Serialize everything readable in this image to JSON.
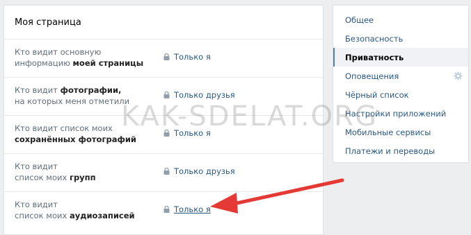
{
  "main": {
    "title": "Моя страница",
    "rows": [
      {
        "label_plain": "Кто видит основную",
        "label_plain2": "информацию ",
        "label_bold": "моей страницы",
        "value": "Только я"
      },
      {
        "label_plain": "Кто видит ",
        "label_bold": "фотографии,",
        "label_plain2": "на которых меня отметили",
        "value": "Только друзья"
      },
      {
        "label_plain": "Кто видит список моих",
        "label_bold": "сохранённых фотографий",
        "value": "Только я"
      },
      {
        "label_plain": "Кто видит",
        "label_plain2": "список моих ",
        "label_bold": "групп",
        "value": "Только друзья"
      },
      {
        "label_plain": "Кто видит",
        "label_plain2": "список моих ",
        "label_bold": "аудиозаписей",
        "value": "Только я"
      }
    ]
  },
  "sidebar": {
    "items": [
      {
        "label": "Общее"
      },
      {
        "label": "Безопасность"
      },
      {
        "label": "Приватность"
      },
      {
        "label": "Оповещения"
      },
      {
        "label": "Чёрный список"
      },
      {
        "label": "Настройки приложений"
      },
      {
        "label": "Мобильные сервисы"
      },
      {
        "label": "Платежи и переводы"
      }
    ],
    "active_index": 2
  },
  "watermark": "KAK-SDELAT.ORG",
  "colors": {
    "accent": "#2a5885",
    "arrow": "#e53935",
    "active_bar": "#5181b8"
  },
  "icons": {
    "lock": "lock-icon",
    "gear": "gear-icon"
  }
}
